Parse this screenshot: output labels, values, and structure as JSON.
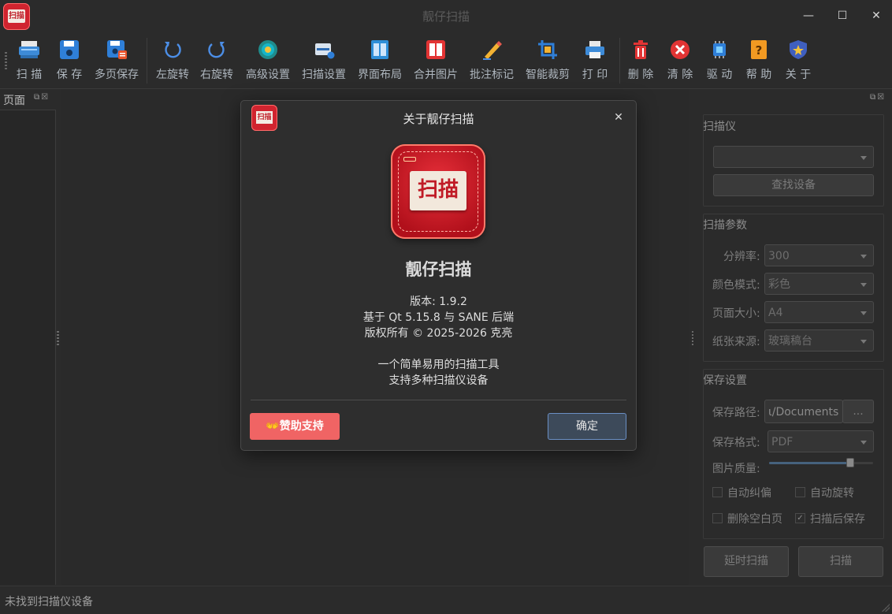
{
  "window": {
    "title": "靓仔扫描",
    "minimize": "—",
    "maximize": "☐",
    "close": "✕"
  },
  "toolbar": {
    "items": [
      {
        "label": "扫 描",
        "icon": "scanner-icon"
      },
      {
        "label": "保 存",
        "icon": "save-icon"
      },
      {
        "label": "多页保存",
        "icon": "multipage-save-icon"
      },
      {
        "label": "左旋转",
        "icon": "rotate-left-icon"
      },
      {
        "label": "右旋转",
        "icon": "rotate-right-icon"
      },
      {
        "label": "高级设置",
        "icon": "advanced-settings-icon"
      },
      {
        "label": "扫描设置",
        "icon": "scan-settings-icon"
      },
      {
        "label": "界面布局",
        "icon": "layout-icon"
      },
      {
        "label": "合并图片",
        "icon": "merge-images-icon"
      },
      {
        "label": "批注标记",
        "icon": "annotate-icon"
      },
      {
        "label": "智能裁剪",
        "icon": "crop-icon"
      },
      {
        "label": "打 印",
        "icon": "printer-icon"
      },
      {
        "label": "删 除",
        "icon": "trash-icon"
      },
      {
        "label": "清 除",
        "icon": "clear-icon"
      },
      {
        "label": "驱 动",
        "icon": "driver-icon"
      },
      {
        "label": "帮 助",
        "icon": "help-icon"
      },
      {
        "label": "关 于",
        "icon": "about-icon"
      }
    ]
  },
  "pages_panel": {
    "title": "页面",
    "buttons": "⧉☒"
  },
  "right_panel": {
    "buttons": "⧉☒",
    "scanner": {
      "title": "扫描仪",
      "device_value": "",
      "find_button": "查找设备"
    },
    "params": {
      "title": "扫描参数",
      "resolution_label": "分辨率:",
      "resolution_value": "300",
      "color_label": "颜色模式:",
      "color_value": "彩色",
      "page_size_label": "页面大小:",
      "page_size_value": "A4",
      "source_label": "纸张来源:",
      "source_value": "玻璃稿台"
    },
    "save": {
      "title": "保存设置",
      "path_label": "保存路径:",
      "path_value": "ɩ/Documents",
      "browse_button": "...",
      "format_label": "保存格式:",
      "format_value": "PDF",
      "quality_label": "图片质量:",
      "quality_fraction": 0.78,
      "auto_deskew": "自动纠偏",
      "auto_rotate": "自动旋转",
      "remove_blank": "删除空白页",
      "save_after_scan": "扫描后保存",
      "save_after_scan_checked": "✓"
    },
    "delay_scan_button": "延时扫描",
    "scan_button": "扫描"
  },
  "status": {
    "text": "未找到扫描仪设备"
  },
  "dialog": {
    "title": "关于靓仔扫描",
    "close": "✕",
    "icon_text": "扫描",
    "logo_text": "扫描",
    "app_name": "靓仔扫描",
    "version": "版本: 1.9.2",
    "based_on": "基于 Qt 5.15.8 与 SANE 后端",
    "copyright": "版权所有 © 2025-2026 克亮",
    "desc1": "一个简单易用的扫描工具",
    "desc2": "支持多种扫描仪设备",
    "sponsor_button": "👐赞助支持",
    "ok_button": "确定"
  }
}
